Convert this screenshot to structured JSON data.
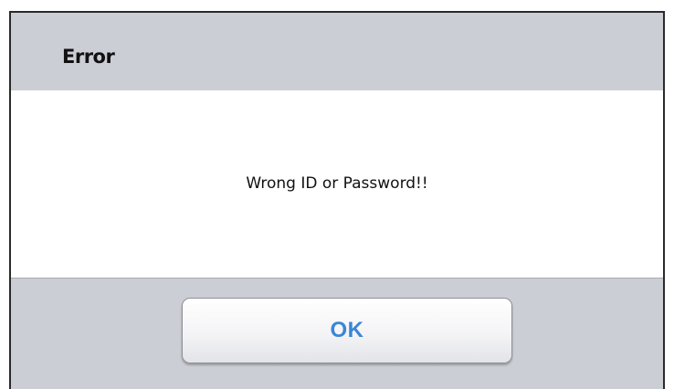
{
  "dialog": {
    "title": "Error",
    "message": "Wrong ID or Password!!",
    "ok_label": "OK"
  },
  "colors": {
    "header_background": "#ccced6",
    "body_background": "#ffffff",
    "button_text": "#3a86d6",
    "border": "#2a2a2a"
  }
}
